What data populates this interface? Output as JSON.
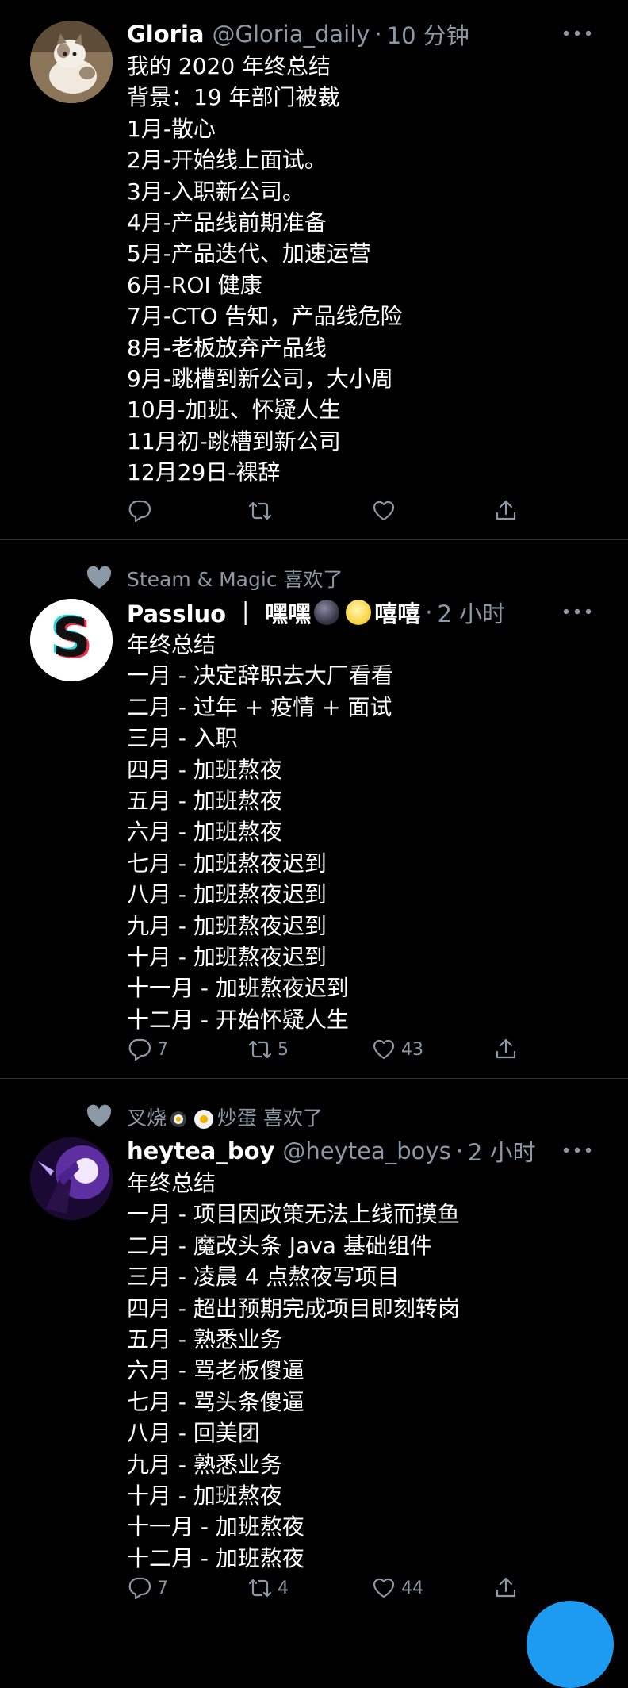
{
  "tweets": [
    {
      "avatar_icon": "cat-avatar",
      "name": "Gloria",
      "handle": "@Gloria_daily",
      "separator": "·",
      "time": "10 分钟",
      "lines": [
        "我的 2020 年终总结",
        "背景：19 年部门被裁",
        "1月-散心",
        "2月-开始线上面试。",
        "3月-入职新公司。",
        "4月-产品线前期准备",
        "5月-产品迭代、加速运营",
        "6月-ROI 健康",
        "7月-CTO 告知，产品线危险",
        "8月-老板放弃产品线",
        "9月-跳槽到新公司，大小周",
        "10月-加班、怀疑人生",
        "11月初-跳槽到新公司",
        "12月29日-裸辞"
      ],
      "actions": {
        "reply": "",
        "retweet": "",
        "like": ""
      }
    },
    {
      "social_context": "Steam & Magic 喜欢了",
      "avatar_icon": "s-logo-avatar",
      "name": "Passluo ｜ 嘿嘿",
      "name_tail": "嘻嘻",
      "separator": "·",
      "time": "2 小时",
      "lines": [
        "年终总结",
        "一月 - 决定辞职去大厂看看",
        "二月 - 过年 + 疫情 + 面试",
        "三月 - 入职",
        "四月 - 加班熬夜",
        "五月 - 加班熬夜",
        "六月 - 加班熬夜",
        "七月 - 加班熬夜迟到",
        "八月 - 加班熬夜迟到",
        "九月 - 加班熬夜迟到",
        "十月 - 加班熬夜迟到",
        "十一月 - 加班熬夜迟到",
        "十二月 - 开始怀疑人生"
      ],
      "actions": {
        "reply": "7",
        "retweet": "5",
        "like": "43"
      }
    },
    {
      "social_context_pre": "叉烧",
      "social_context_post": "炒蛋 喜欢了",
      "avatar_icon": "anime-avatar",
      "name": "heytea_boy",
      "handle": "@heytea_boys",
      "separator": "·",
      "time": "2 小时",
      "lines": [
        "年终总结",
        "一月 - 项目因政策无法上线而摸鱼",
        "二月 - 魔改头条 Java 基础组件",
        "三月 - 凌晨 4 点熬夜写项目",
        "四月 - 超出预期完成项目即刻转岗",
        "五月 - 熟悉业务",
        "六月 - 骂老板傻逼",
        "七月 - 骂头条傻逼",
        "八月 - 回美团",
        "九月 - 熟悉业务",
        "十月 - 加班熬夜",
        "十一月 - 加班熬夜",
        "十二月 - 加班熬夜"
      ],
      "actions": {
        "reply": "7",
        "retweet": "4",
        "like": "44"
      }
    }
  ],
  "colors": {
    "background": "#000000",
    "text": "#ffffff",
    "secondary": "#8b98a5",
    "divider": "#2f3336",
    "accent": "#1d9bf0"
  }
}
